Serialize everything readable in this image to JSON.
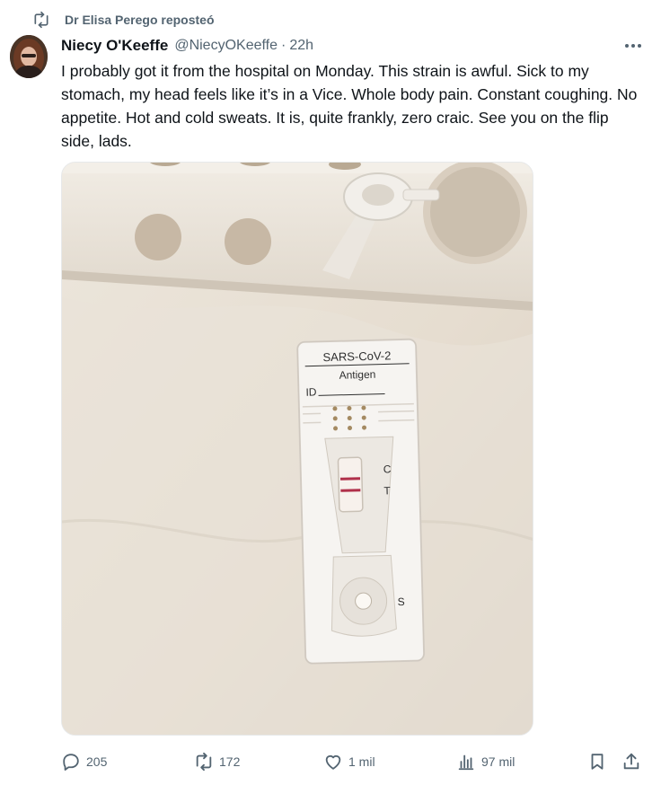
{
  "repost": {
    "icon": "repost-icon",
    "text": "Dr Elisa Perego reposteó"
  },
  "tweet": {
    "author_name": "Niecy O'Keeffe",
    "handle": "@NiecyOKeeffe",
    "separator": "·",
    "time": "22h",
    "text": "I probably got it from the hospital on Monday. This strain is awful. Sick to my stomach, my head feels like it’s in a Vice. Whole body pain. Constant coughing. No appetite. Hot and cold sweats. It is, quite frankly, zero craic. See you on the flip side, lads."
  },
  "media": {
    "test_brand_line1": "SARS-CoV-2",
    "test_brand_line2": "Antigen",
    "id_label": "ID",
    "control_label": "C",
    "test_label": "T",
    "sample_label": "S"
  },
  "actions": {
    "replies": "205",
    "reposts": "172",
    "likes": "1 mil",
    "views": "97 mil"
  },
  "colors": {
    "text_primary": "#0f1419",
    "text_secondary": "#536471",
    "line_red": "#b0304a"
  }
}
